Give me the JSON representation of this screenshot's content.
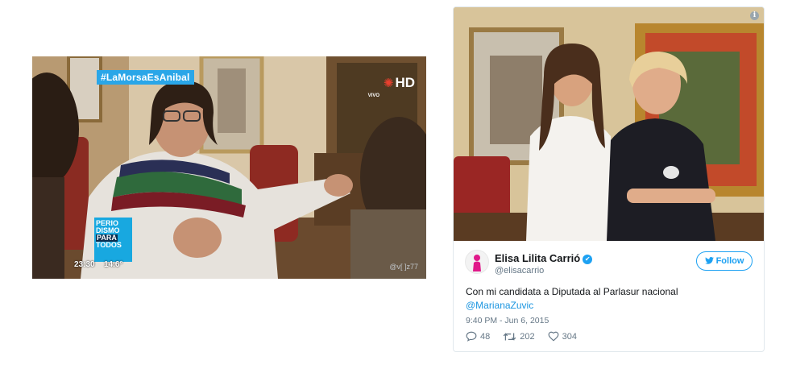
{
  "tv": {
    "hashtag": "#LaMorsaEsAnibal",
    "channel_badge": "HD",
    "live_label": "VIVO",
    "show_logo": [
      "PERIO",
      "DISMO",
      "PARA",
      "TODOS"
    ],
    "time": "23:30",
    "temperature": "14.6°",
    "watermark": "@v[ ]z77"
  },
  "tweet": {
    "author_name": "Elisa Lilita Carrió",
    "verified_icon": "✔",
    "handle": "@elisacarrio",
    "follow_label": "Follow",
    "text": "Con mi candidata a Diputada al Parlasur nacional",
    "mention": "@MarianaZuvic",
    "timestamp": "9:40 PM - Jun 6, 2015",
    "replies": "48",
    "retweets": "202",
    "likes": "304",
    "info_icon": "i"
  },
  "colors": {
    "twitter_blue": "#1da1f2",
    "link_blue": "#1b95e0",
    "muted": "#657786",
    "hashtag_bg": "#2aa6e8"
  },
  "icons": [
    "info-icon",
    "verified-badge-icon",
    "twitter-bird-icon",
    "reply-icon",
    "retweet-icon",
    "like-icon"
  ]
}
